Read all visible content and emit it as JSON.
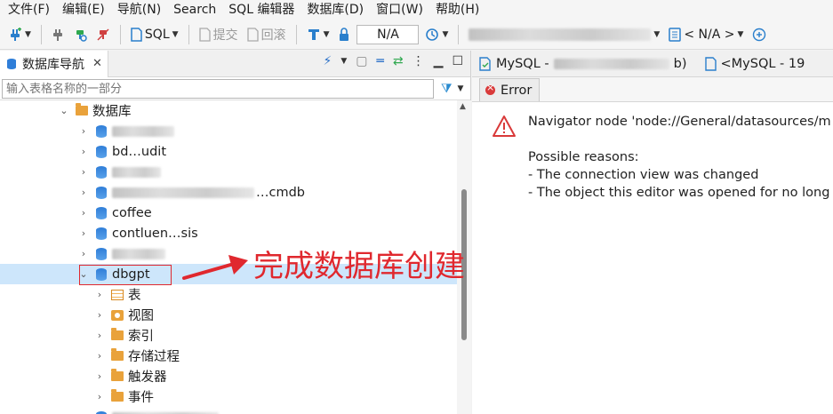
{
  "menu": [
    "文件(F)",
    "编辑(E)",
    "导航(N)",
    "Search",
    "SQL 编辑器",
    "数据库(D)",
    "窗口(W)",
    "帮助(H)"
  ],
  "toolbar": {
    "sql_label": "SQL",
    "commit_label": "提交",
    "rollback_label": "回滚",
    "txn_field": "N/A",
    "schema_selector": "< N/A >"
  },
  "navigator": {
    "tab_label": "数据库导航",
    "filter_placeholder": "输入表格名称的一部分",
    "root_label": "数据库",
    "databases": [
      {
        "label": "",
        "obscured": true
      },
      {
        "label": "bd…udit",
        "obscured": true
      },
      {
        "label": "",
        "obscured": true
      },
      {
        "label": "…cmdb",
        "obscured": true
      },
      {
        "label": "coffee",
        "obscured": true
      },
      {
        "label": "contluen…sis",
        "obscured": true
      },
      {
        "label": "…",
        "obscured": true
      },
      {
        "label": "dbgpt",
        "obscured": false
      }
    ],
    "dbgpt_children": [
      "表",
      "视图",
      "索引",
      "存储过程",
      "触发器",
      "事件"
    ]
  },
  "annotation": {
    "text": "完成数据库创建",
    "color": "#e0282e"
  },
  "editor": {
    "tab1_label": "MySQL -",
    "tab1_suffix": "b)",
    "tab2_label": "<MySQL - 19",
    "error_tab_label": "Error",
    "message_line1": "Navigator node 'node://General/datasources/m",
    "message_line2": "Possible reasons:",
    "message_line3": " - The connection view was changed",
    "message_line4": " - The object this editor was opened for no long"
  }
}
